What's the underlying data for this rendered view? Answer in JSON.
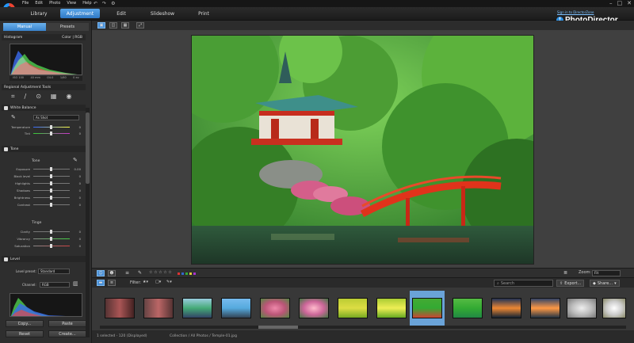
{
  "menubar": {
    "items": [
      "File",
      "Edit",
      "Photo",
      "View",
      "Help"
    ]
  },
  "modes": [
    "Library",
    "Adjustment",
    "Edit",
    "Slideshow",
    "Print"
  ],
  "active_mode": "Adjustment",
  "signin": "Sign in to DirectorZone",
  "brand": {
    "name": "PhotoDirector",
    "badge": "↑"
  },
  "left_panel": {
    "tabs": [
      "Manual",
      "Presets"
    ],
    "histogram": {
      "title": "Histogram",
      "mode": "Color | RGB",
      "info": [
        "ISO 100",
        "40 mm",
        "f/4.0",
        "1/60",
        "0 ev"
      ]
    },
    "regional": {
      "title": "Regional Adjustment Tools"
    },
    "white_balance": {
      "title": "White Balance",
      "preset": "As Shot",
      "sliders": [
        {
          "label": "Temperature",
          "value": "0"
        },
        {
          "label": "Tint",
          "value": "0"
        }
      ]
    },
    "tone": {
      "title": "Tone",
      "sub_tone": "Tone",
      "sliders": [
        {
          "label": "Exposure",
          "value": "0.00"
        },
        {
          "label": "Black level",
          "value": "0"
        },
        {
          "label": "Highlights",
          "value": "0"
        },
        {
          "label": "Shadows",
          "value": "0"
        },
        {
          "label": "Brightness",
          "value": "0"
        },
        {
          "label": "Contrast",
          "value": "0"
        }
      ],
      "sub_tinge": "Tinge",
      "tinge_sliders": [
        {
          "label": "Clarity",
          "value": "0"
        },
        {
          "label": "Vibrancy",
          "value": "0"
        },
        {
          "label": "Saturation",
          "value": "0"
        }
      ]
    },
    "level": {
      "title": "Level",
      "preset_label": "Level preset:",
      "preset": "Standard",
      "channel_label": "Channel:",
      "channel": "RGB"
    },
    "buttons": {
      "copy": "Copy...",
      "paste": "Paste",
      "reset": "Reset",
      "create": "Create..."
    }
  },
  "bottom": {
    "zoom_label": "Zoom:",
    "zoom_value": "Fit",
    "filter_label": "Filter:",
    "search_placeholder": "Search",
    "export": "Export...",
    "share": "Share..."
  },
  "status": {
    "selected": "1 selected - 120 (Displayed)",
    "path": "Collection / All Photos / Temple-01.jpg"
  },
  "colors": {
    "accent": "#3a84cc",
    "label_red": "#d33",
    "label_blue": "#36c",
    "label_green": "#3a3",
    "label_yellow": "#dc3",
    "label_purple": "#a3c"
  }
}
